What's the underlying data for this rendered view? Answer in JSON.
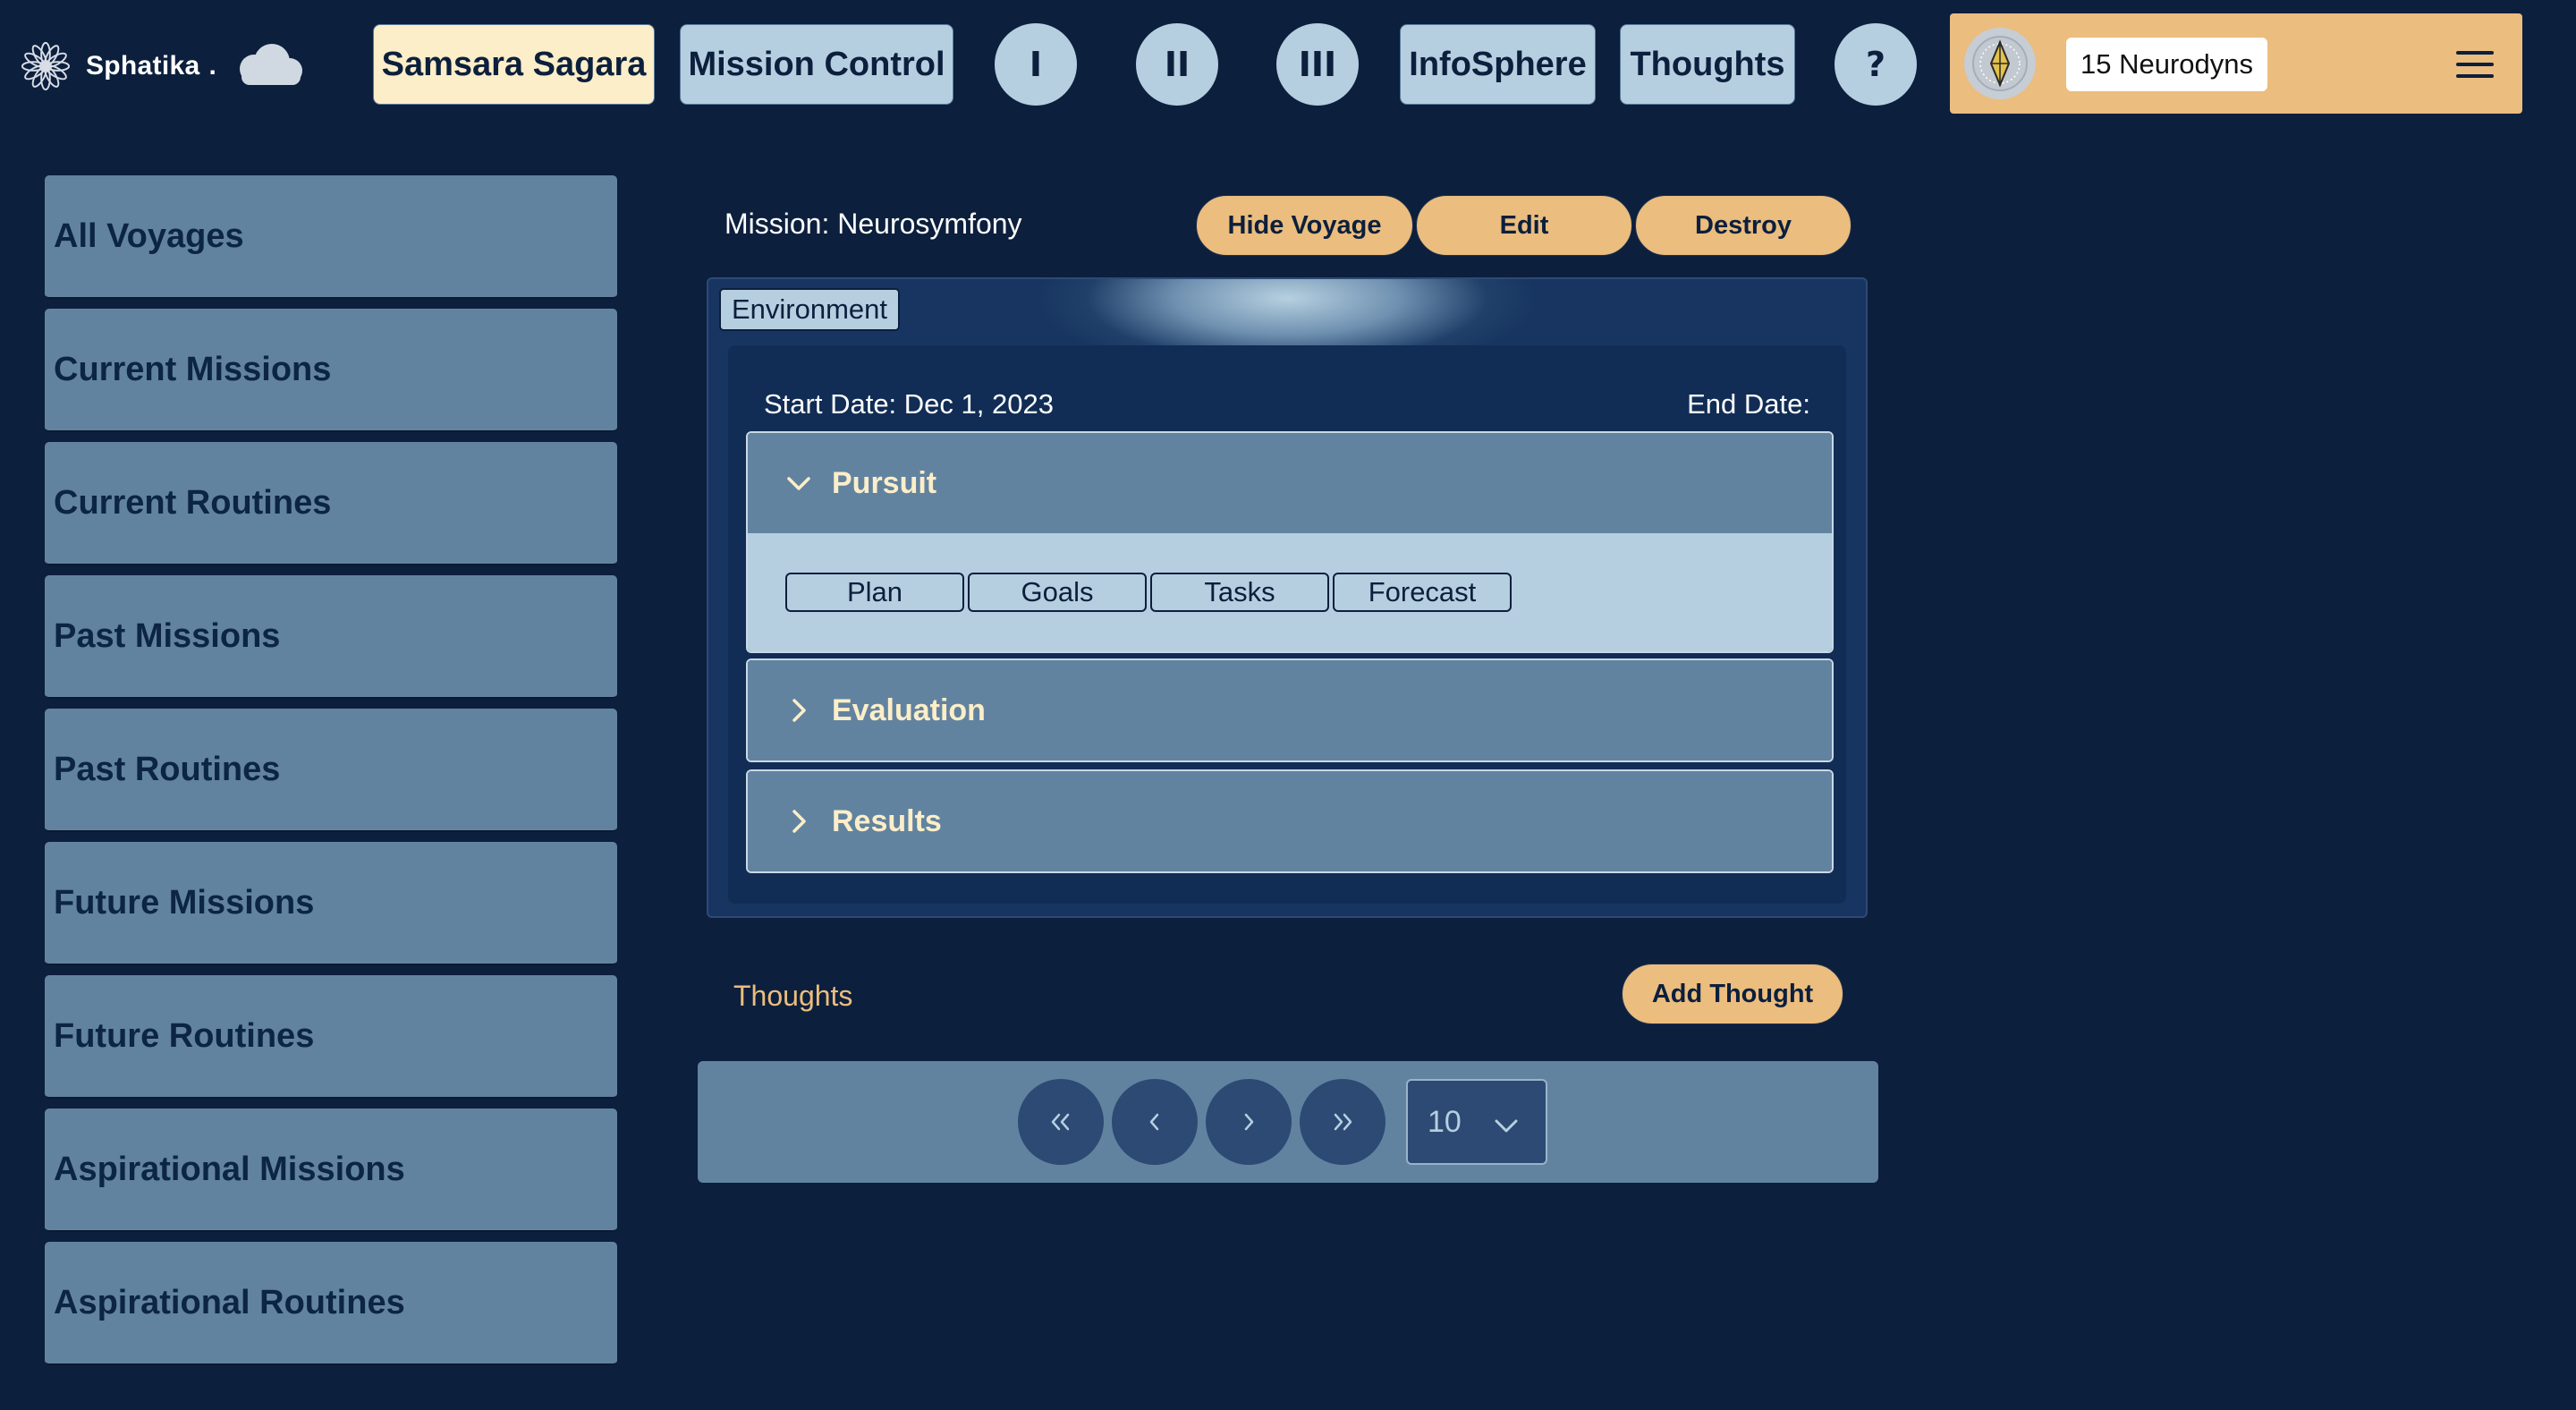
{
  "brand": {
    "name": "Sphatika",
    "dot": ".",
    "logo_icon": "lotus-flower-icon",
    "cloud_icon": "cloud-icon"
  },
  "nav": {
    "samsara": "Samsara Sagara",
    "mission_control": "Mission Control",
    "level1": "I",
    "level2": "II",
    "level3": "III",
    "infosphere": "InfoSphere",
    "thoughts": "Thoughts",
    "help": "?"
  },
  "user": {
    "credits": "15 Neurodyns",
    "avatar_icon": "crystal-avatar-icon",
    "menu_icon": "hamburger-menu-icon"
  },
  "sidebar": {
    "items": [
      {
        "label": "All Voyages"
      },
      {
        "label": "Current Missions"
      },
      {
        "label": "Current Routines"
      },
      {
        "label": "Past Missions"
      },
      {
        "label": "Past Routines"
      },
      {
        "label": "Future Missions"
      },
      {
        "label": "Future Routines"
      },
      {
        "label": "Aspirational Missions"
      },
      {
        "label": "Aspirational Routines"
      }
    ]
  },
  "mission": {
    "title": "Mission: Neurosymfony",
    "hide_label": "Hide Voyage",
    "edit_label": "Edit",
    "destroy_label": "Destroy"
  },
  "environment": {
    "tab_label": "Environment",
    "start_date": "Start Date: Dec 1, 2023",
    "end_date": "End Date:",
    "sections": [
      {
        "label": "Pursuit",
        "expanded": true
      },
      {
        "label": "Evaluation",
        "expanded": false
      },
      {
        "label": "Results",
        "expanded": false
      }
    ],
    "pursuit_tabs": [
      "Plan",
      "Goals",
      "Tasks",
      "Forecast"
    ]
  },
  "thoughts": {
    "label": "Thoughts",
    "add_label": "Add Thought"
  },
  "pagination": {
    "page_size": "10"
  },
  "colors": {
    "background": "#0c1f3d",
    "light_blue": "#b6cfe0",
    "slate_blue": "#6283a0",
    "gold": "#ebbd7e",
    "cream": "#fbeec8"
  }
}
